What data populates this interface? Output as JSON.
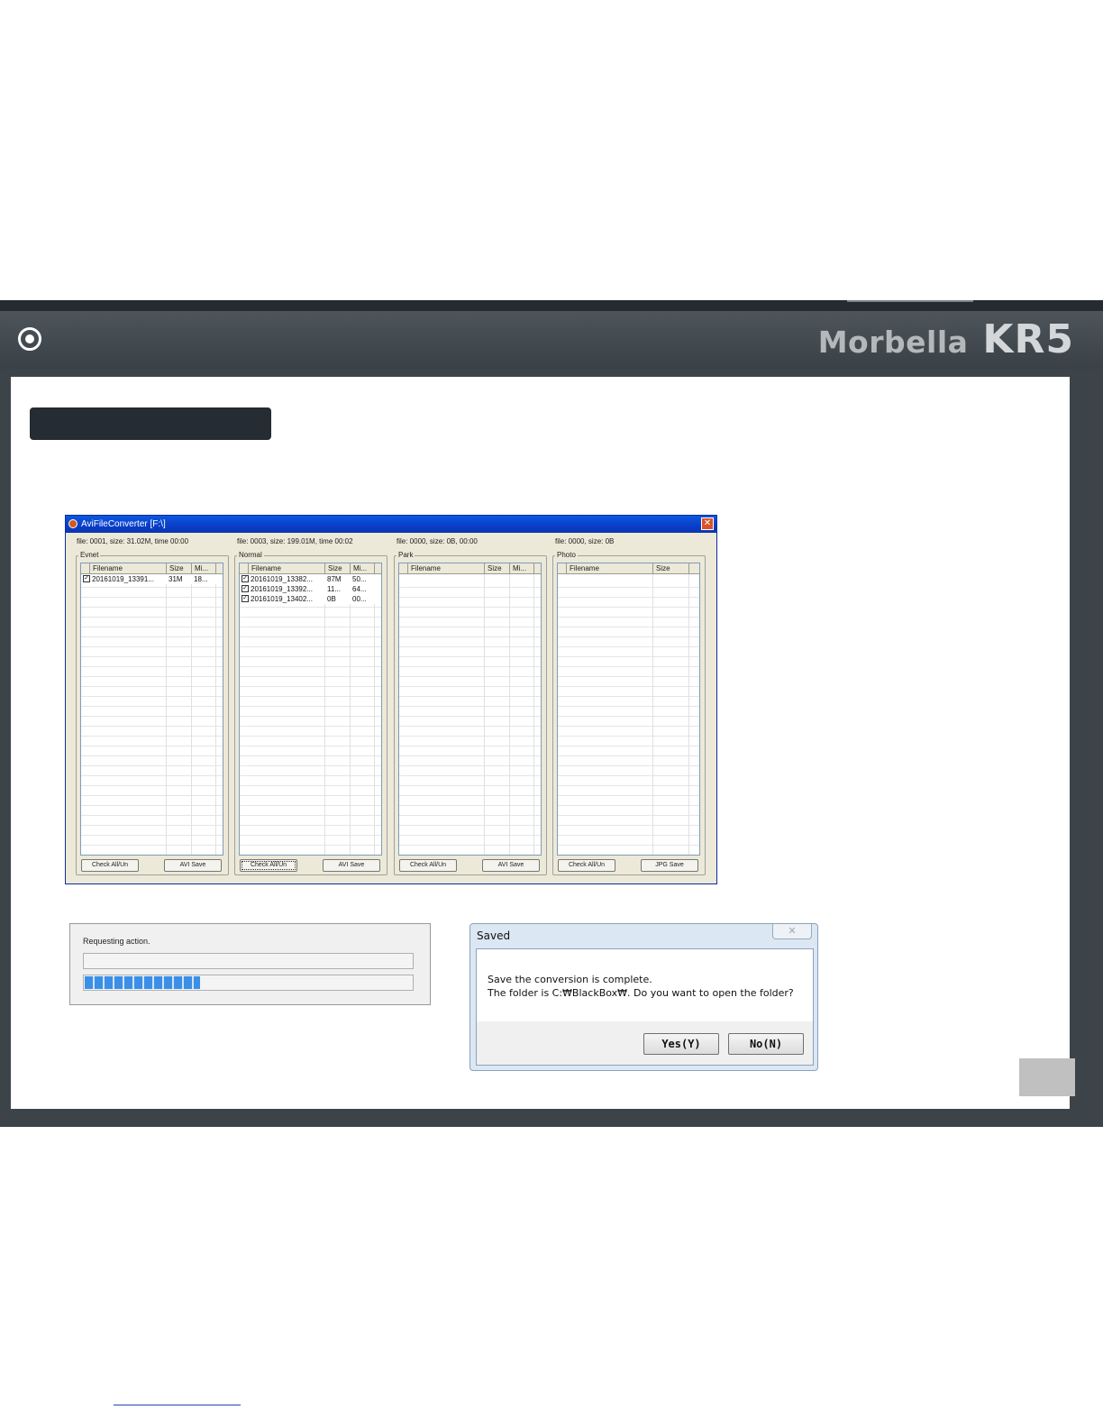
{
  "header": {
    "brand_name": "Morbella",
    "brand_model": "KR5"
  },
  "section_label": "",
  "page_number": "",
  "app": {
    "title": "AviFileConverter [F:\\]",
    "close_glyph": "✕",
    "panels": [
      {
        "id": "event",
        "info": "file: 0001, size: 31.02M, time 00:00",
        "label": "Evnet",
        "columns": [
          "Filename",
          "Size",
          "Mi..."
        ],
        "rows": [
          {
            "checked": true,
            "filename": "20161019_13391...",
            "size": "31M",
            "misc": "18..."
          }
        ],
        "buttons": [
          "Check All/Un",
          "AVI Save"
        ]
      },
      {
        "id": "normal",
        "info": "file: 0003, size: 199.01M, time 00:02",
        "label": "Normal",
        "columns": [
          "Filename",
          "Size",
          "Mi..."
        ],
        "rows": [
          {
            "checked": true,
            "filename": "20161019_13382...",
            "size": "87M",
            "misc": "50..."
          },
          {
            "checked": true,
            "filename": "20161019_13392...",
            "size": "11...",
            "misc": "64..."
          },
          {
            "checked": true,
            "filename": "20161019_13402...",
            "size": "0B",
            "misc": "00..."
          }
        ],
        "buttons": [
          "Check All/Un",
          "AVI Save"
        ]
      },
      {
        "id": "park",
        "info": "file: 0000, size: 0B, 00:00",
        "label": "Park",
        "columns": [
          "Filename",
          "Size",
          "Mi..."
        ],
        "rows": [],
        "buttons": [
          "Check All/Un",
          "AVI Save"
        ]
      },
      {
        "id": "photo",
        "info": "file: 0000, size: 0B",
        "label": "Photo",
        "columns": [
          "Filename",
          "Size"
        ],
        "rows": [],
        "buttons": [
          "Check All/Un",
          "JPG Save"
        ]
      }
    ]
  },
  "progress_dialog": {
    "text": "Requesting action.",
    "progress_fraction": 0.35
  },
  "saved_dialog": {
    "title": "Saved",
    "close_glyph": "✕",
    "line1": "Save the conversion is complete.",
    "line2": "The folder is C:₩BlackBox₩. Do you want to open the folder?",
    "yes_label": "Yes(Y)",
    "no_label": "No(N)"
  }
}
